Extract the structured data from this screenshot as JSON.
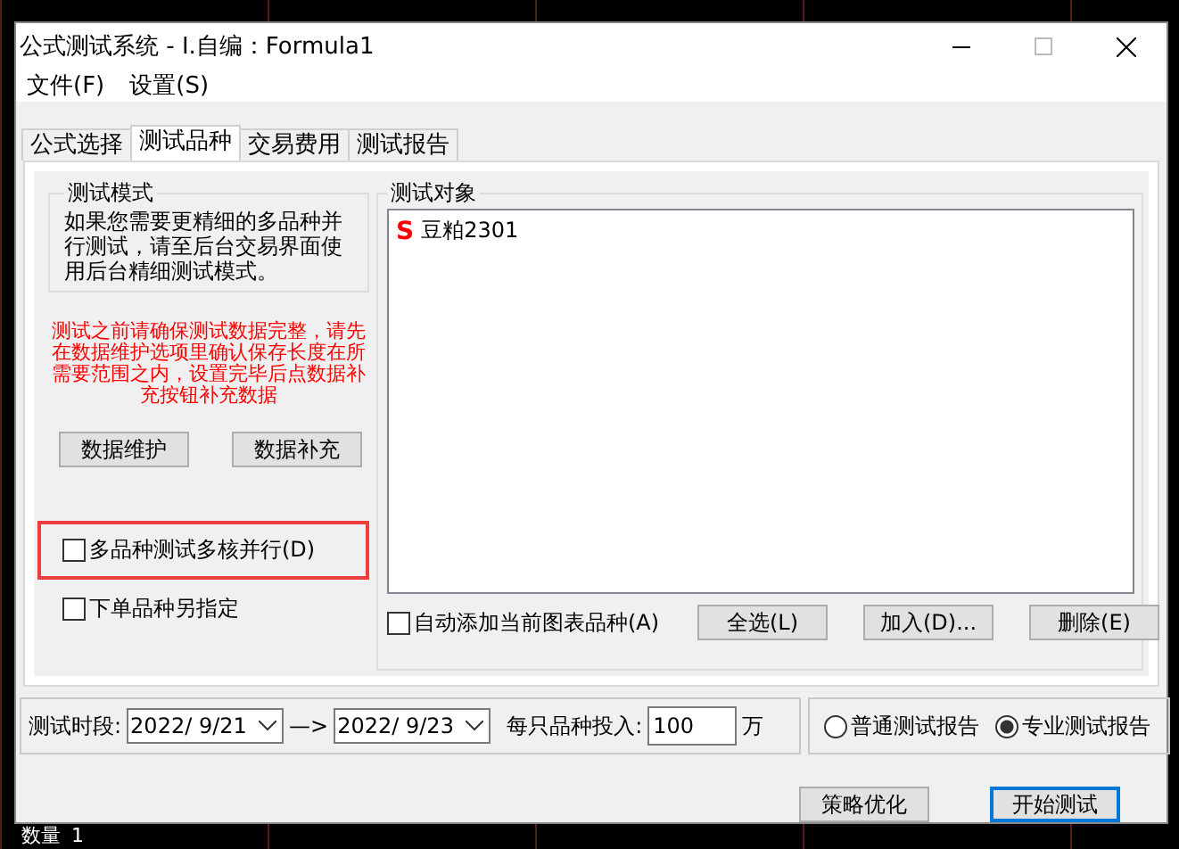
{
  "window": {
    "title": "公式测试系统 - I.自编：Formula1"
  },
  "menu": [
    "文件(F)",
    "设置(S)"
  ],
  "tabs": [
    {
      "label": "公式选择",
      "selected": false
    },
    {
      "label": "测试品种",
      "selected": true
    },
    {
      "label": "交易费用",
      "selected": false
    },
    {
      "label": "测试报告",
      "selected": false
    }
  ],
  "test_mode": {
    "title": "测试模式",
    "text": "如果您需要更精细的多品种并行测试，请至后台交易界面使用后台精细测试模式。"
  },
  "warning": "测试之前请确保测试数据完整，请先在数据维护选项里确认保存长度在所需要范围之内，设置完毕后点数据补充按钮补充数据",
  "data_buttons": [
    "数据维护",
    "数据补充"
  ],
  "options": [
    {
      "label": "多品种测试多核并行(D)",
      "checked": false,
      "highlighted": true
    },
    {
      "label": "下单品种另指定",
      "checked": false,
      "highlighted": false
    }
  ],
  "test_objects": {
    "title": "测试对象",
    "items": [
      {
        "marker": "S",
        "name": "豆粕2301"
      }
    ],
    "auto_add": {
      "label": "自动添加当前图表品种(A)",
      "checked": false
    },
    "buttons": [
      "全选(L)",
      "加入(D)...",
      "删除(E)"
    ]
  },
  "period": {
    "label": "测试时段:",
    "start": "2022/ 9/21",
    "arrow": "—>",
    "end": "2022/ 9/23",
    "invest_label": "每只品种投入:",
    "invest_value": "100",
    "unit": "万"
  },
  "report_type": [
    {
      "label": "普通测试报告",
      "selected": false
    },
    {
      "label": "专业测试报告",
      "selected": true
    }
  ],
  "actions": [
    {
      "label": "策略优化",
      "default": false
    },
    {
      "label": "开始测试",
      "default": true
    }
  ],
  "background": {
    "label": "数量",
    "value": "1"
  }
}
